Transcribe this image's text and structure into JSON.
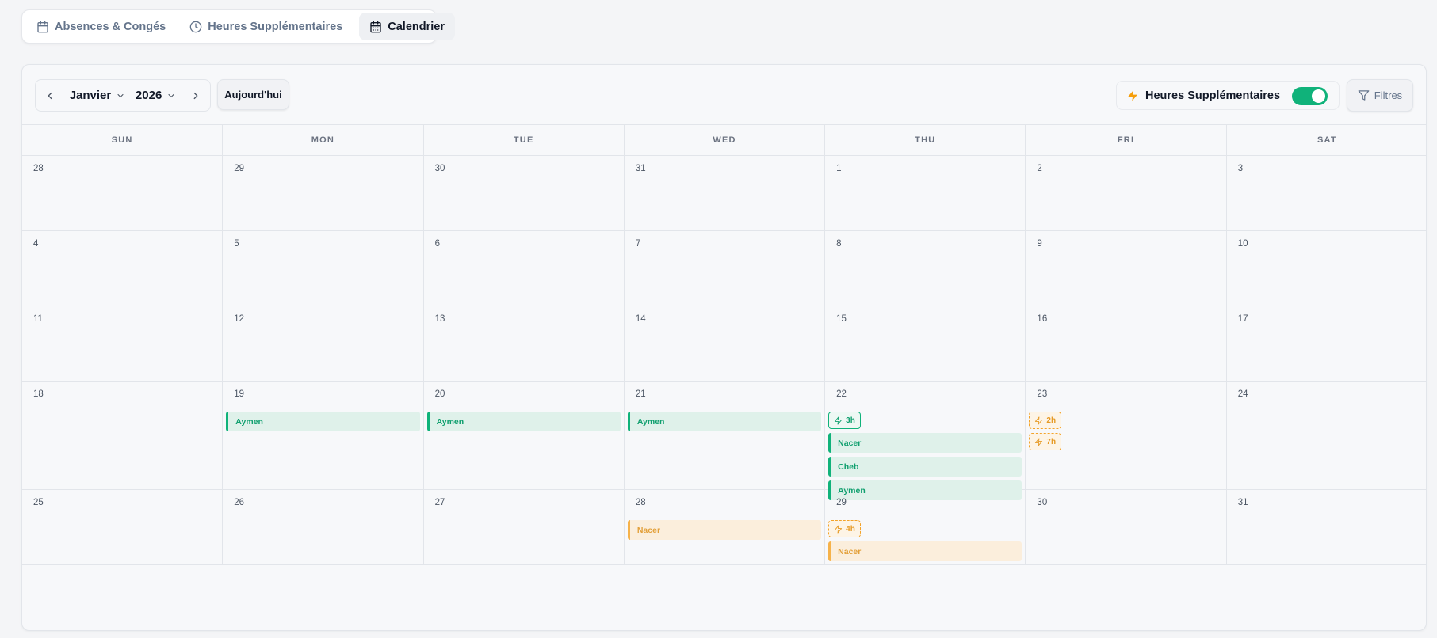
{
  "tabs": [
    {
      "label": "Absences & Congés",
      "icon": "calendar-icon",
      "active": false
    },
    {
      "label": "Heures Supplémentaires",
      "icon": "clock-icon",
      "active": false
    },
    {
      "label": "Calendrier",
      "icon": "calendar-grid-icon",
      "active": true
    }
  ],
  "toolbar": {
    "month": "Janvier",
    "year": "2026",
    "today_label": "Aujourd'hui",
    "overtime_toggle_label": "Heures Supplémentaires",
    "overtime_toggle_on": true,
    "filters_label": "Filtres"
  },
  "colors": {
    "green": "#10b27a",
    "orange": "#f6b24a"
  },
  "weekdays": [
    "SUN",
    "MON",
    "TUE",
    "WED",
    "THU",
    "FRI",
    "SAT"
  ],
  "weeks": [
    {
      "days": [
        {
          "num": "28",
          "events": []
        },
        {
          "num": "29",
          "events": []
        },
        {
          "num": "30",
          "events": []
        },
        {
          "num": "31",
          "events": []
        },
        {
          "num": "1",
          "events": []
        },
        {
          "num": "2",
          "events": []
        },
        {
          "num": "3",
          "events": []
        }
      ]
    },
    {
      "days": [
        {
          "num": "4",
          "events": []
        },
        {
          "num": "5",
          "events": []
        },
        {
          "num": "6",
          "events": []
        },
        {
          "num": "7",
          "events": []
        },
        {
          "num": "8",
          "events": []
        },
        {
          "num": "9",
          "events": []
        },
        {
          "num": "10",
          "events": []
        }
      ]
    },
    {
      "days": [
        {
          "num": "11",
          "events": []
        },
        {
          "num": "12",
          "events": []
        },
        {
          "num": "13",
          "events": []
        },
        {
          "num": "14",
          "events": []
        },
        {
          "num": "15",
          "events": []
        },
        {
          "num": "16",
          "events": []
        },
        {
          "num": "17",
          "events": []
        }
      ]
    },
    {
      "days": [
        {
          "num": "18",
          "events": []
        },
        {
          "num": "19",
          "events": [
            {
              "type": "bar",
              "color": "green",
              "label": "Aymen"
            }
          ]
        },
        {
          "num": "20",
          "events": [
            {
              "type": "bar",
              "color": "green",
              "label": "Aymen"
            }
          ]
        },
        {
          "num": "21",
          "events": [
            {
              "type": "bar",
              "color": "green",
              "label": "Aymen"
            }
          ]
        },
        {
          "num": "22",
          "events": [
            {
              "type": "chip",
              "color": "green",
              "label": "3h"
            },
            {
              "type": "bar",
              "color": "green",
              "label": "Nacer"
            },
            {
              "type": "bar",
              "color": "green",
              "label": "Cheb"
            },
            {
              "type": "bar",
              "color": "green",
              "label": "Aymen"
            }
          ]
        },
        {
          "num": "23",
          "events": [
            {
              "type": "chip",
              "color": "orange",
              "label": "2h"
            },
            {
              "type": "chip",
              "color": "orange",
              "label": "7h"
            }
          ]
        },
        {
          "num": "24",
          "events": []
        }
      ]
    },
    {
      "days": [
        {
          "num": "25",
          "events": []
        },
        {
          "num": "26",
          "events": []
        },
        {
          "num": "27",
          "events": []
        },
        {
          "num": "28",
          "events": [
            {
              "type": "bar",
              "color": "orange",
              "label": "Nacer"
            }
          ]
        },
        {
          "num": "29",
          "events": [
            {
              "type": "chip",
              "color": "orange",
              "label": "4h"
            },
            {
              "type": "bar",
              "color": "orange",
              "label": "Nacer"
            }
          ]
        },
        {
          "num": "30",
          "events": []
        },
        {
          "num": "31",
          "events": []
        }
      ]
    }
  ]
}
